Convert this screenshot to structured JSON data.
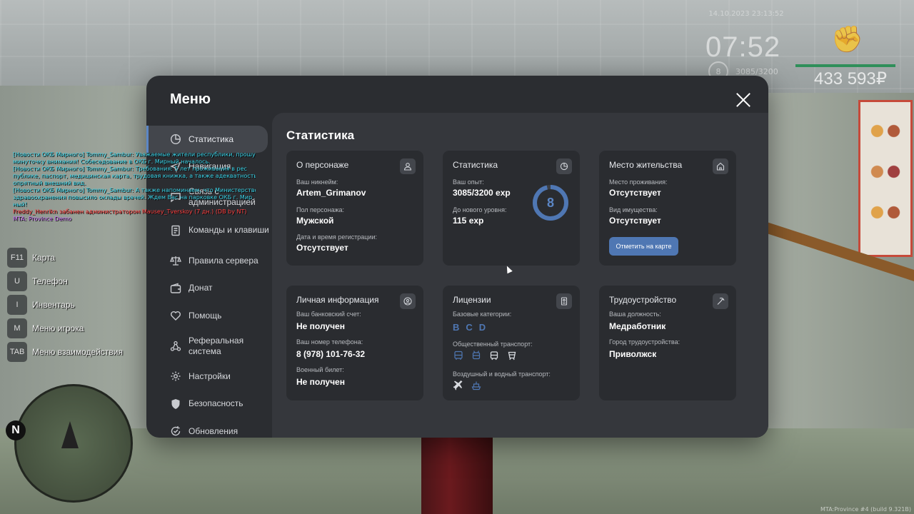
{
  "hud": {
    "date": "14.10.2023 23:13:52",
    "time": "07:52",
    "level": "8",
    "exp": "3085/3200",
    "money": "433 593₽"
  },
  "chat": [
    {
      "text": "[Новости ОКБ Мирного] Tommy_Sambur: Уважаемые жители республики, прошу",
      "color": "#39d3e8"
    },
    {
      "text": "минуточку внимания! Собеседование в ОКБ г. Мирный началось.",
      "color": "#39d3e8"
    },
    {
      "text": "[Новости ОКБ Мирного] Tommy_Sambur: Требования: 5 лет проживания в рес",
      "color": "#39d3e8"
    },
    {
      "text": "публике, паспорт, медицинская карта, трудовая книжка, а также адекватность и",
      "color": "#39d3e8"
    },
    {
      "text": " опрятный внешний вид.",
      "color": "#39d3e8"
    },
    {
      "text": "[Новости ОКБ Мирного] Tommy_Sambur: А также напоминаем, что Министерство",
      "color": "#39d3e8"
    },
    {
      "text": " здравоохранения повысило оклады врачей. Ждем Вас на парковке ОКБ г. Мир",
      "color": "#39d3e8"
    },
    {
      "text": "ный!",
      "color": "#39d3e8"
    },
    {
      "text": "Freddy_Henrikn забанен администратором Mausey_Tverskoy (7 дн.) (DB by NT)",
      "color": "#ff4040"
    },
    {
      "text": "MTA: Province Demo",
      "color": "#c36cf0"
    }
  ],
  "keys": [
    {
      "key": "F11",
      "label": "Карта"
    },
    {
      "key": "U",
      "label": "Телефон"
    },
    {
      "key": "I",
      "label": "Инвентарь"
    },
    {
      "key": "M",
      "label": "Меню игрока"
    },
    {
      "key": "TAB",
      "label": "Меню взаимодействия"
    }
  ],
  "minimap": {
    "north": "N"
  },
  "footer": "MTA:Province #4 (build 9.321B)",
  "menu": {
    "title": "Меню",
    "nav": [
      {
        "label": "Статистика",
        "icon": "pie-chart-icon"
      },
      {
        "label": "Навигация",
        "icon": "navigation-icon"
      },
      {
        "label": "Связь с администрацией",
        "icon": "chat-icon"
      },
      {
        "label": "Команды и клавиши",
        "icon": "document-icon"
      },
      {
        "label": "Правила сервера",
        "icon": "scales-icon"
      },
      {
        "label": "Донат",
        "icon": "wallet-icon"
      },
      {
        "label": "Помощь",
        "icon": "heart-hand-icon"
      },
      {
        "label": "Реферальная система",
        "icon": "network-icon"
      },
      {
        "label": "Настройки",
        "icon": "gear-icon"
      },
      {
        "label": "Безопасность",
        "icon": "shield-icon"
      },
      {
        "label": "Обновления",
        "icon": "refresh-check-icon"
      }
    ],
    "content_title": "Статистика",
    "cards": {
      "character": {
        "title": "О персонаже",
        "nickname_label": "Ваш никнейм:",
        "nickname": "Artem_Grimanov",
        "gender_label": "Пол персонажа:",
        "gender": "Мужской",
        "reg_label": "Дата и время регистрации:",
        "reg": "Отсутствует"
      },
      "stats": {
        "title": "Статистика",
        "exp_label": "Ваш опыт:",
        "exp": "3085/3200 exp",
        "next_label": "До нового уровня:",
        "next": "115 exp",
        "level": "8",
        "progress": 0.964
      },
      "residence": {
        "title": "Место жительства",
        "place_label": "Место проживания:",
        "place": "Отсутствует",
        "property_label": "Вид имущества:",
        "property": "Отсутствует",
        "button": "Отметить на карте"
      },
      "personal": {
        "title": "Личная информация",
        "bank_label": "Ваш банковский счет:",
        "bank": "Не получен",
        "phone_label": "Ваш номер телефона:",
        "phone": "8 (978) 101-76-32",
        "military_label": "Военный билет:",
        "military": "Не получен"
      },
      "licenses": {
        "title": "Лицензии",
        "base_label": "Базовые категории:",
        "categories": [
          "B",
          "C",
          "D"
        ],
        "public_label": "Общественный транспорт:",
        "air_label": "Воздушный и водный транспорт:"
      },
      "employment": {
        "title": "Трудоустройство",
        "position_label": "Ваша должность:",
        "position": "Медработник",
        "city_label": "Город трудоустройства:",
        "city": "Приволжск"
      }
    }
  },
  "colors": {
    "accent": "#5b86c5",
    "panel": "#2b2d31",
    "card": "#2a2c30"
  }
}
